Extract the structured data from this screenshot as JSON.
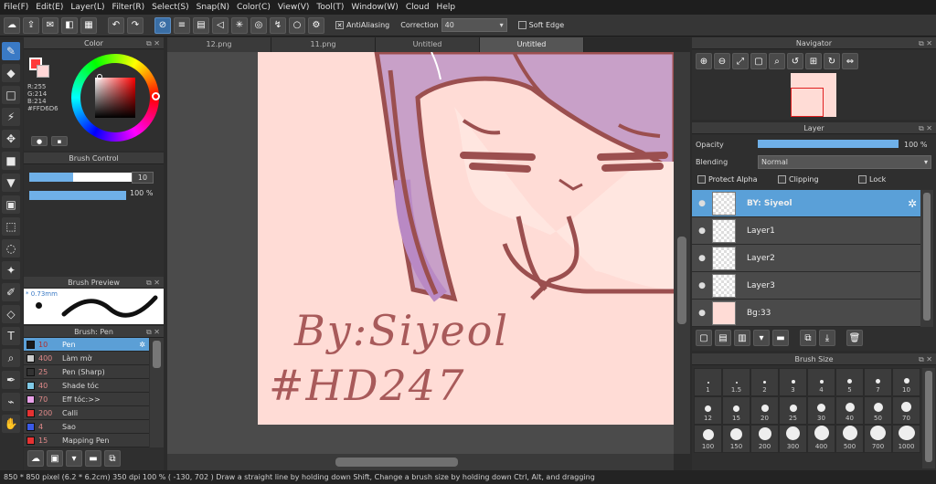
{
  "menu": [
    "File(F)",
    "Edit(E)",
    "Layer(L)",
    "Filter(R)",
    "Select(S)",
    "Snap(N)",
    "Color(C)",
    "View(V)",
    "Tool(T)",
    "Window(W)",
    "Cloud",
    "Help"
  ],
  "toolbar": {
    "antialiasing_label": "AntiAliasing",
    "correction_label": "Correction",
    "correction_value": "40",
    "soft_edge_label": "Soft Edge"
  },
  "color_panel": {
    "title": "Color",
    "r": "R:255",
    "g": "G:214",
    "b": "B:214",
    "hex": "#FFD6D6",
    "fg_color": "#ff3a3a",
    "bg_color": "#ffd6d6"
  },
  "brush_control": {
    "title": "Brush Control",
    "size_value": "10",
    "opacity_value": "100 %",
    "size_fraction": 0.35,
    "opacity_fraction": 1.0
  },
  "brush_preview": {
    "title": "Brush Preview",
    "size_label": "* 0.73mm"
  },
  "brush_list": {
    "title": "Brush: Pen",
    "items": [
      {
        "size": "10",
        "name": "Pen",
        "color": "#1a1a1a",
        "selected": true
      },
      {
        "size": "400",
        "name": "Làm mờ",
        "color": "#cccccc"
      },
      {
        "size": "25",
        "name": "Pen (Sharp)",
        "color": "#333333"
      },
      {
        "size": "40",
        "name": "Shade tóc",
        "color": "#7fc9e6"
      },
      {
        "size": "70",
        "name": "Eff tóc:>>",
        "color": "#e8a0e8"
      },
      {
        "size": "200",
        "name": "Calli",
        "color": "#e63232"
      },
      {
        "size": "4",
        "name": "Sao",
        "color": "#3a5ae6"
      },
      {
        "size": "15",
        "name": "Mapping Pen",
        "color": "#e63232"
      }
    ]
  },
  "tabs": [
    "12.png",
    "11.png",
    "Untitled",
    "Untitled"
  ],
  "canvas_text": {
    "line1": "By:Siyeol",
    "line2": "#HD247"
  },
  "navigator": {
    "title": "Navigator"
  },
  "layer_panel": {
    "title": "Layer",
    "opacity_label": "Opacity",
    "opacity_value": "100 %",
    "blending_label": "Blending",
    "blending_value": "Normal",
    "protect_alpha": "Protect Alpha",
    "clipping": "Clipping",
    "lock": "Lock",
    "layers": [
      {
        "name": "BY: Siyeol",
        "selected": true
      },
      {
        "name": "Layer1"
      },
      {
        "name": "Layer2"
      },
      {
        "name": "Layer3"
      },
      {
        "name": "Bg:33"
      }
    ]
  },
  "brush_size": {
    "title": "Brush Size",
    "sizes": [
      "1",
      "1.5",
      "2",
      "3",
      "4",
      "5",
      "7",
      "10",
      "12",
      "15",
      "20",
      "25",
      "30",
      "40",
      "50",
      "70",
      "100",
      "150",
      "200",
      "300",
      "400",
      "500",
      "700",
      "1000"
    ]
  },
  "status": {
    "dims": "850 * 850 pixel",
    "cm": "(6.2 * 6.2cm)",
    "dpi": "350 dpi",
    "zoom": "100 %",
    "coords": "( -130, 702 )",
    "hint": "Draw a straight line by holding down Shift, Change a brush size by holding down Ctrl, Alt, and dragging"
  }
}
